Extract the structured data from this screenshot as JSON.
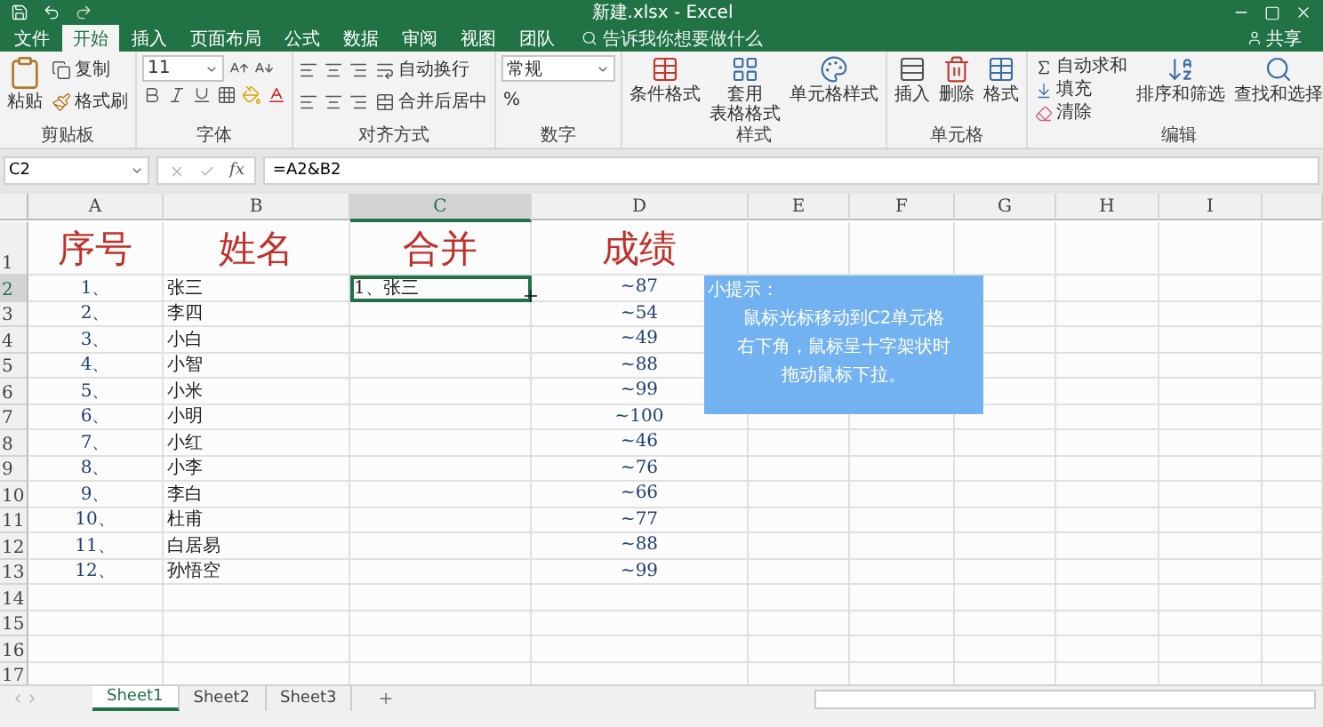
{
  "title_bar": {
    "title": "新建.xlsx - Excel"
  },
  "menu_tabs": [
    {
      "label": "文件",
      "selected": false
    },
    {
      "label": "开始",
      "selected": true
    },
    {
      "label": "插入",
      "selected": false
    },
    {
      "label": "页面布局",
      "selected": false
    },
    {
      "label": "公式",
      "selected": false
    },
    {
      "label": "数据",
      "selected": false
    },
    {
      "label": "审阅",
      "selected": false
    },
    {
      "label": "视图",
      "selected": false
    },
    {
      "label": "团队",
      "selected": false
    }
  ],
  "tell_me": "告诉我你想要做什么",
  "share": "共享",
  "ribbon": {
    "clipboard": {
      "paste": "粘贴",
      "copy": "复制",
      "format_painter": "格式刷",
      "label": "剪贴板"
    },
    "font": {
      "size": "11",
      "label": "字体"
    },
    "alignment": {
      "wrap": "自动换行",
      "merge": "合并后居中",
      "label": "对齐方式"
    },
    "number": {
      "format": "常规",
      "percent": "%",
      "label": "数字"
    },
    "styles": {
      "conditional": "条件格式",
      "table_line1": "套用",
      "table_line2": "表格格式",
      "cell_styles": "单元格样式",
      "label": "样式"
    },
    "cells": {
      "insert": "插入",
      "delete": "删除",
      "format": "格式",
      "label": "单元格"
    },
    "editing": {
      "autosum": "自动求和",
      "fill": "填充",
      "clear": "清除",
      "sort": "排序和筛选",
      "find": "查找和选择",
      "label": "编辑"
    }
  },
  "name_box": "C2",
  "formula_label": "fx",
  "formula": "=A2&B2",
  "columns": [
    {
      "label": "A",
      "selected": false
    },
    {
      "label": "B",
      "selected": false
    },
    {
      "label": "C",
      "selected": true
    },
    {
      "label": "D",
      "selected": false
    },
    {
      "label": "E",
      "selected": false
    },
    {
      "label": "F",
      "selected": false
    },
    {
      "label": "G",
      "selected": false
    },
    {
      "label": "H",
      "selected": false
    },
    {
      "label": "I",
      "selected": false
    }
  ],
  "header_row": {
    "number": "1",
    "cells": [
      "序号",
      "姓名",
      "合并",
      "成绩"
    ]
  },
  "rows": [
    {
      "number": "2",
      "selected": true,
      "a": "1、",
      "b": "张三",
      "c": "1、张三",
      "d": "~87"
    },
    {
      "number": "3",
      "selected": false,
      "a": "2、",
      "b": "李四",
      "d": "~54"
    },
    {
      "number": "4",
      "selected": false,
      "a": "3、",
      "b": "小白",
      "d": "~49"
    },
    {
      "number": "5",
      "selected": false,
      "a": "4、",
      "b": "小智",
      "d": "~88"
    },
    {
      "number": "6",
      "selected": false,
      "a": "5、",
      "b": "小米",
      "d": "~99"
    },
    {
      "number": "7",
      "selected": false,
      "a": "6、",
      "b": "小明",
      "d": "~100"
    },
    {
      "number": "8",
      "selected": false,
      "a": "7、",
      "b": "小红",
      "d": "~46"
    },
    {
      "number": "9",
      "selected": false,
      "a": "8、",
      "b": "小李",
      "d": "~76"
    },
    {
      "number": "10",
      "selected": false,
      "a": "9、",
      "b": "李白",
      "d": "~66"
    },
    {
      "number": "11",
      "selected": false,
      "a": "10、",
      "b": "杜甫",
      "d": "~77"
    },
    {
      "number": "12",
      "selected": false,
      "a": "11、",
      "b": "白居易",
      "d": "~88"
    },
    {
      "number": "13",
      "selected": false,
      "a": "12、",
      "b": "孙悟空",
      "d": "~99"
    }
  ],
  "empty_rows": [
    "14",
    "15",
    "16",
    "17"
  ],
  "tip": {
    "title": "小提示：",
    "lines": [
      "鼠标光标移动到C2单元格",
      "右下角，鼠标呈十字架状时",
      "拖动鼠标下拉。"
    ]
  },
  "sheets": [
    {
      "label": "Sheet1",
      "selected": true
    },
    {
      "label": "Sheet2",
      "selected": false
    },
    {
      "label": "Sheet3",
      "selected": false
    }
  ]
}
